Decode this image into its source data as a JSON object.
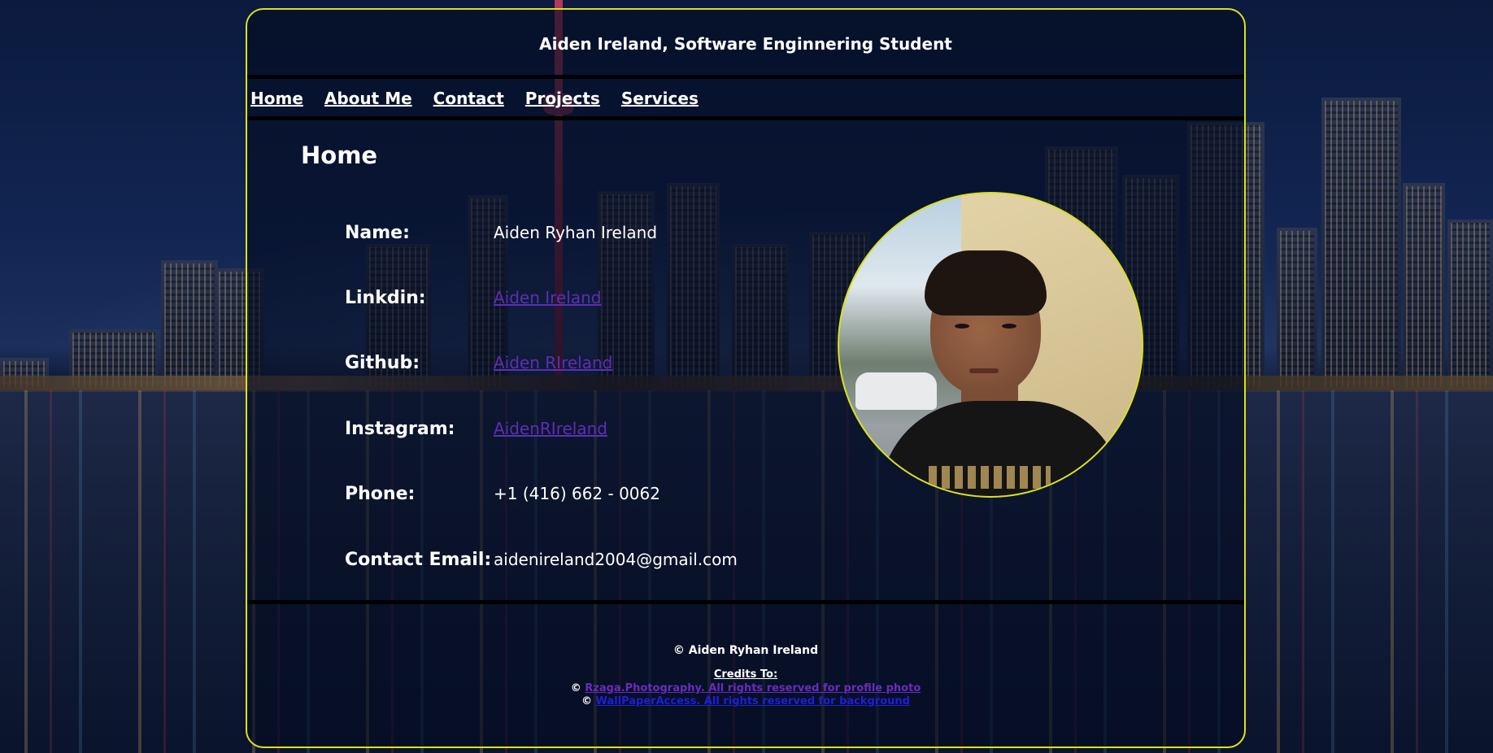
{
  "header": {
    "title": "Aiden Ireland, Software Enginnering Student"
  },
  "nav": {
    "items": [
      {
        "label": "Home"
      },
      {
        "label": "About Me"
      },
      {
        "label": "Contact"
      },
      {
        "label": "Projects"
      },
      {
        "label": "Services"
      }
    ]
  },
  "main": {
    "heading": "Home",
    "info": {
      "name_label": "Name:",
      "name_value": "Aiden Ryhan Ireland",
      "linkedin_label": "Linkdin:",
      "linkedin_value": "Aiden Ireland",
      "github_label": "Github:",
      "github_value": "Aiden RIreland",
      "instagram_label": "Instagram:",
      "instagram_value": "AidenRIreland",
      "phone_label": "Phone:",
      "phone_value": "+1 (416) 662 - 0062",
      "email_label": "Contact Email:",
      "email_value": "aidenireland2004@gmail.com"
    },
    "portrait": {
      "icon": "profile-photo"
    }
  },
  "footer": {
    "copyright": "© Aiden Ryhan Ireland",
    "credits_title": "Credits To:",
    "credit1_prefix": "© ",
    "credit1_link": "Rzaga.Photography. All rights reserved for profile photo",
    "credit2_prefix": "© ",
    "credit2_link": "WallPaperAccess. All rights reserved for background"
  },
  "colors": {
    "panel_border": "#d9e21a",
    "link_visited": "#6a2bbf",
    "link_unvisited": "#1f1fd6",
    "text": "#ffffff"
  }
}
